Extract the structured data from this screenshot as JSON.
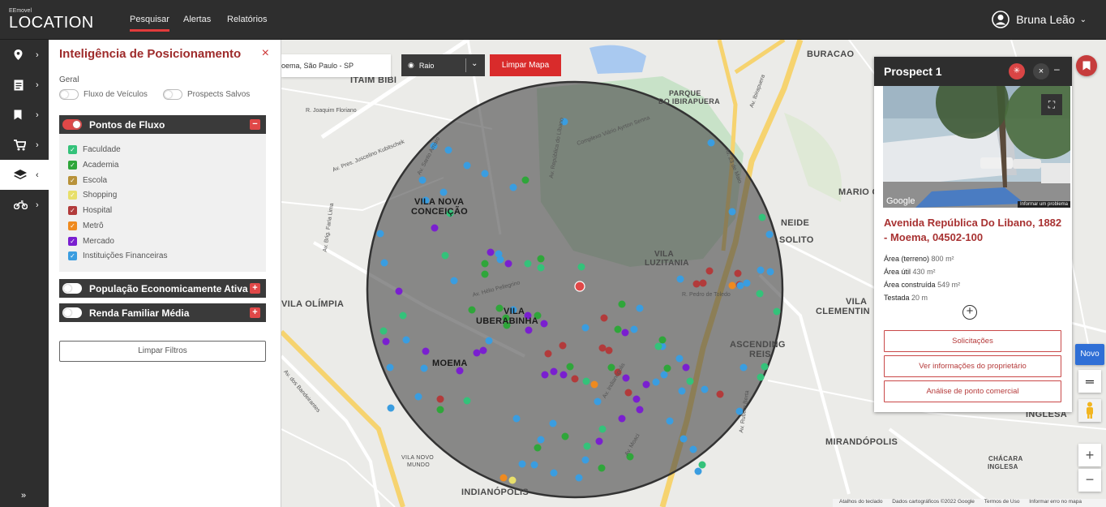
{
  "brand": {
    "top": "EEmovel",
    "name": "LOCATION"
  },
  "nav": [
    "Pesquisar",
    "Alertas",
    "Relatórios"
  ],
  "user": {
    "name": "Bruna Leão"
  },
  "panel": {
    "title": "Inteligência de Posicionamento",
    "close": "×",
    "group_label": "Geral",
    "toggles": [
      "Fluxo de Veículos",
      "Prospects Salvos"
    ],
    "accordions": [
      "Pontos de Fluxo",
      "População Economicamente Ativa",
      "Renda Familiar Média"
    ],
    "minus": "−",
    "plus": "+",
    "checkboxes": [
      {
        "label": "Faculdade",
        "color": "#34c27a"
      },
      {
        "label": "Academia",
        "color": "#2fa63a"
      },
      {
        "label": "Escola",
        "color": "#b8923a"
      },
      {
        "label": "Shopping",
        "color": "#e8df6a"
      },
      {
        "label": "Hospital",
        "color": "#b23b3b"
      },
      {
        "label": "Metrô",
        "color": "#ef8a1f"
      },
      {
        "label": "Mercado",
        "color": "#7a1fd0"
      },
      {
        "label": "Instituições Financeiras",
        "color": "#3a9de0"
      }
    ],
    "clear_button": "Limpar Filtros"
  },
  "map": {
    "search_value": "oema, São Paulo - SP",
    "radius_label": "Raio",
    "clear_map": "Limpar Mapa",
    "labels": [
      "ITAIM BIBI",
      "VILA NOVA",
      "CONCEIÇÃO",
      "VILA OLÍMPIA",
      "VILA",
      "UBERABINHA",
      "MOEMA",
      "INDIANÓPOLIS",
      "PARQUE",
      "DO IBIRAPUERA",
      "BURACAO",
      "MARIO C",
      "VILA",
      "LUZITANIA",
      "NEIDE",
      "SOLITO",
      "VILA",
      "CLEMENTIN",
      "ASCENDING",
      "REIS",
      "MIRANDÓPOLIS",
      "INGLESA",
      "CHÁCARA",
      "INGLESA",
      "VILA NOVO",
      "MUNDO"
    ],
    "streets": [
      "Av. Santo Amaro",
      "Av. República do Líbano",
      "Complexo Viário Ayrton Senna",
      "Av. Ibirapuera",
      "Av. Rubem Berta",
      "Av. Hélio Pellegrino",
      "Av. Pres. Juscelino Kubitschek",
      "Av. Brig. Faria Lima",
      "Av. dos Bandeirantes",
      "Av. 23 de Maio",
      "R. Joaquim Floriano",
      "Av. Indianópolis",
      "R. Pedro de Toledo",
      "Av. Moaci"
    ],
    "footer": [
      "Atalhos do teclado",
      "Dados cartográficos ©2022 Google",
      "Termos de Uso",
      "Informar erro no mapa"
    ],
    "new_button": "Novo"
  },
  "prospect": {
    "title": "Prospect 1",
    "pin_icon": "pin-icon",
    "close": "×",
    "min": "–",
    "photo_brand": "Google",
    "photo_report": "Informar um problema",
    "address": "Avenida República Do Libano, 1882 - Moema, 04502-100",
    "info": [
      {
        "label": "Área (terreno)",
        "value": "800 m²"
      },
      {
        "label": "Área útil",
        "value": "430 m²"
      },
      {
        "label": "Área construída",
        "value": "549 m²"
      },
      {
        "label": "Testada",
        "value": "20 m"
      }
    ],
    "buttons": [
      "Solicitações",
      "Ver informações do proprietário",
      "Análise de ponto comercial"
    ]
  }
}
